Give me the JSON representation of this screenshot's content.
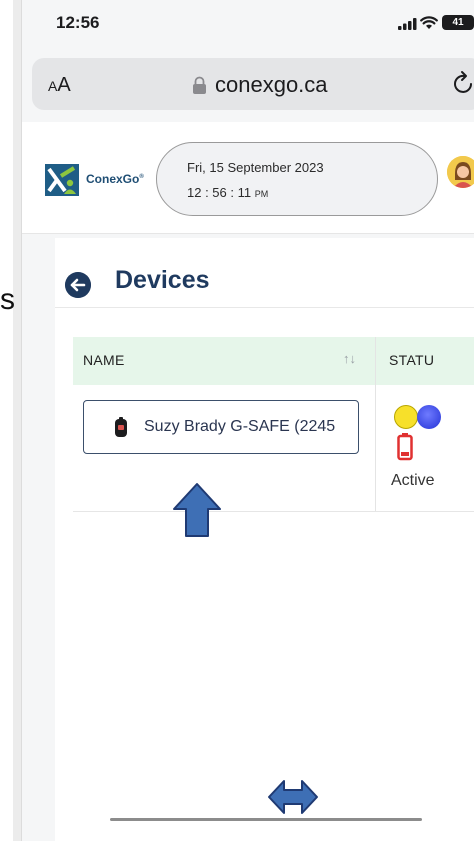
{
  "status_bar": {
    "time": "12:56",
    "battery": "41"
  },
  "address_bar": {
    "aa_small": "A",
    "aa_large": "A",
    "url": "conexgo.ca"
  },
  "header": {
    "logo_text": "ConexGo",
    "logo_mark": "®",
    "date": "Fri, 15 September 2023",
    "time": "12 : 56 : 11",
    "ampm": "PM"
  },
  "stray_text": "s",
  "page": {
    "title": "Devices"
  },
  "table": {
    "columns": [
      {
        "label": "NAME"
      },
      {
        "label": "STATU"
      }
    ],
    "sort_glyph": "↑↓",
    "rows": [
      {
        "name": "Suzy Brady G-SAFE (2245",
        "status": "Active"
      }
    ]
  },
  "colors": {
    "accent": "#1f3a5f",
    "header_row": "#e6f6ea",
    "annotation_arrow": "#3e6fb5",
    "battery_low": "#e03131",
    "status_dot_yellow": "#f7e02a",
    "status_dot_blue": "#3a48e0"
  }
}
